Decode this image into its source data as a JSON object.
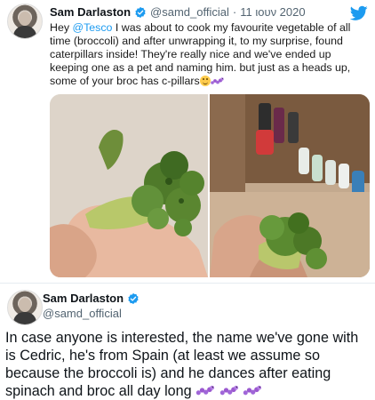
{
  "tweet1": {
    "author_name": "Sam Darlaston",
    "handle": "@samd_official",
    "separator": "·",
    "date": "11 ιουν 2020",
    "text_before": "Hey ",
    "mention": "@Tesco",
    "text_after": " I was about to cook my favourite vegetable of all time (broccoli) and after unwrapping it, to my surprise, found caterpillars inside! They're really nice and we've ended up keeping one as a pet and naming him. but just as a heads up, some of your broc has c-pillars",
    "emojis": [
      "smile-icon",
      "caterpillar-icon"
    ],
    "photos": [
      "broccoli-in-hand-photo",
      "broccoli-kitchen-photo"
    ]
  },
  "tweet2": {
    "author_name": "Sam Darlaston",
    "handle": "@samd_official",
    "text": "In case anyone is interested, the name we've gone with is Cedric, he's from Spain (at least we assume so because the broccoli is) and he dances after eating spinach and broc all day long ",
    "emojis": [
      "caterpillar-icon",
      "caterpillar-icon",
      "caterpillar-icon"
    ]
  },
  "colors": {
    "link": "#1d9bf0",
    "verified": "#1d9bf0",
    "handle": "#536471",
    "twitter_blue": "#1d9bf0",
    "caterpillar": "#9b59d0"
  }
}
